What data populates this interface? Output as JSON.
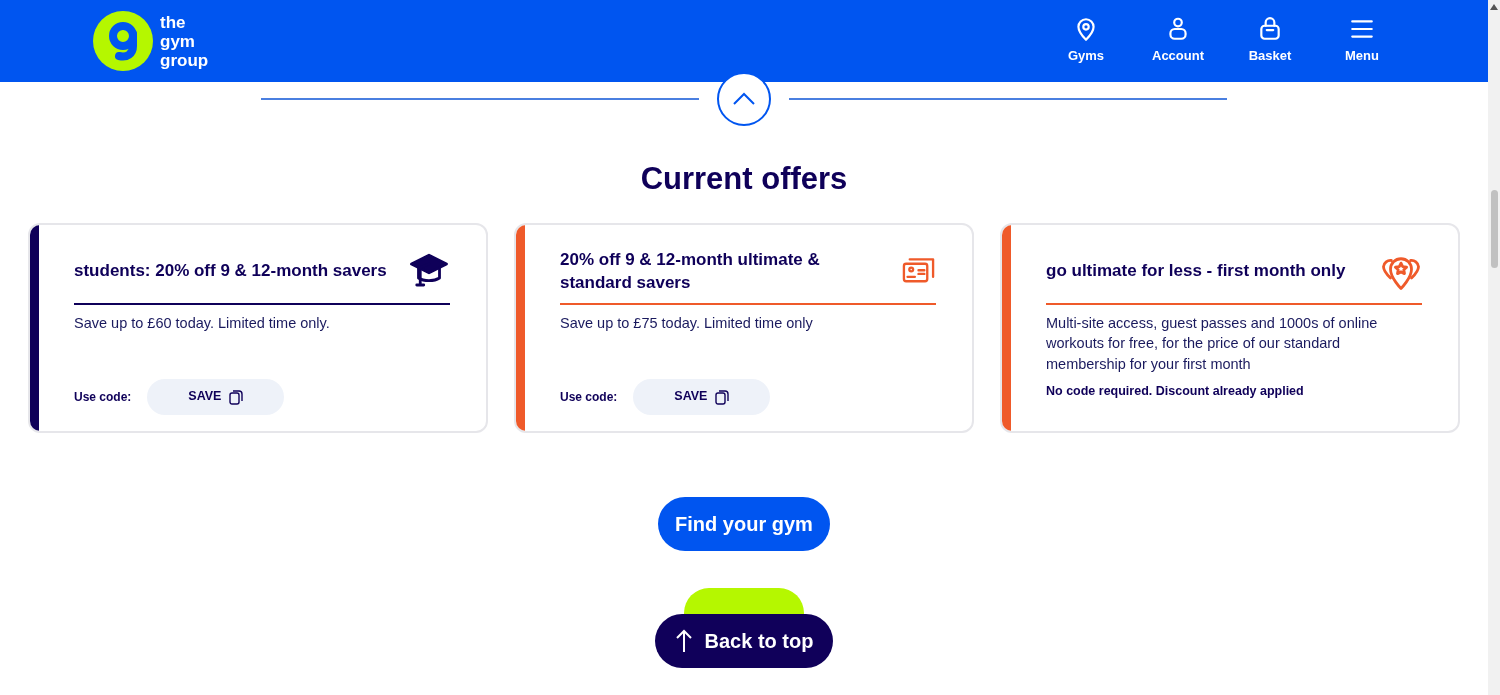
{
  "header": {
    "logo_text": [
      "the",
      "gym",
      "group"
    ],
    "nav": [
      {
        "label": "Gyms"
      },
      {
        "label": "Account"
      },
      {
        "label": "Basket"
      },
      {
        "label": "Menu"
      }
    ]
  },
  "section": {
    "title": "Current offers"
  },
  "offers": [
    {
      "title": "students: 20% off 9 & 12-month savers",
      "color": "#0f0059",
      "description": "Save up to £60 today. Limited time only.",
      "kind": "code",
      "code_label": "Use code:",
      "code": "SAVE"
    },
    {
      "title": "20% off 9 & 12-month ultimate & standard savers",
      "color": "#ef5a2a",
      "description": "Save up to £75 today. Limited time only",
      "kind": "code",
      "code_label": "Use code:",
      "code": "SAVE"
    },
    {
      "title": "go ultimate for less - first month only",
      "color": "#ef5a2a",
      "description": "Multi-site access, guest passes and 1000s of online workouts for free, for the price of our standard membership for your first month",
      "kind": "note",
      "note": "No code required. Discount already applied"
    }
  ],
  "buttons": {
    "find": "Find your gym",
    "back_to_top": "Back to top"
  }
}
